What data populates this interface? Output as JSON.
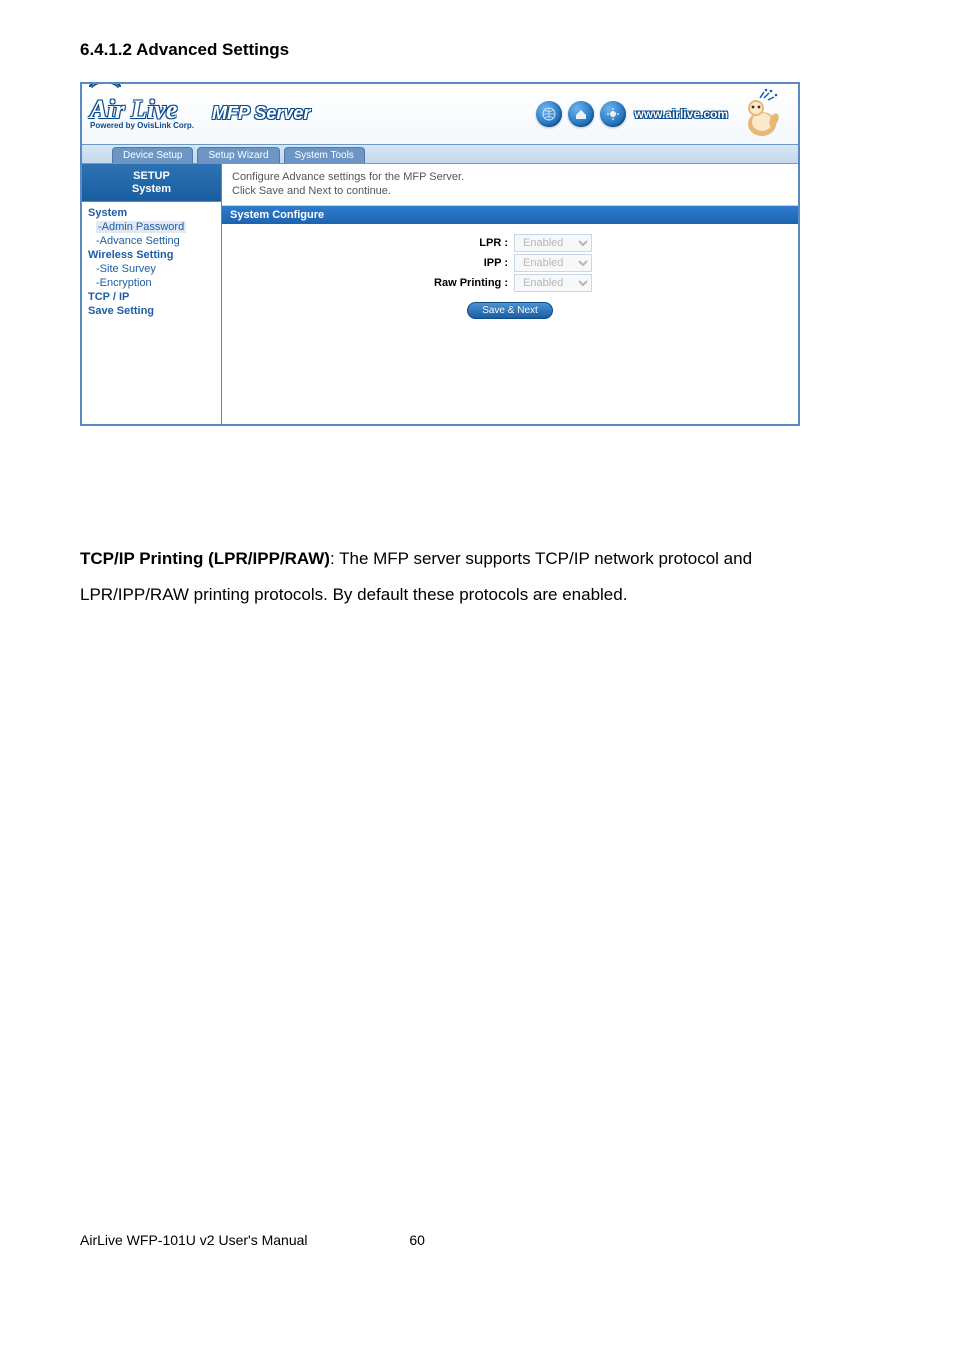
{
  "section": {
    "title": "6.4.1.2    Advanced Settings"
  },
  "logo": {
    "brand": "Air Live",
    "powered": "Powered by OvisLink Corp.",
    "product": "MFP Server",
    "site": "www.airlive.com"
  },
  "tabs": [
    "Device Setup",
    "Setup Wizard",
    "System Tools"
  ],
  "sidebar": {
    "header_line1": "SETUP",
    "header_line2": "System",
    "items": {
      "system": "System",
      "admin_password": "-Admin Password",
      "advance_setting": "-Advance Setting",
      "wireless_setting": "Wireless Setting",
      "site_survey": "-Site Survey",
      "encryption": "-Encryption",
      "tcpip": "TCP / IP",
      "save_setting": "Save Setting"
    }
  },
  "content": {
    "desc_line1": "Configure Advance settings for the MFP Server.",
    "desc_line2": "Click Save and Next to continue.",
    "panel_title": "System Configure",
    "rows": {
      "lpr": {
        "label": "LPR :",
        "value": "Enabled"
      },
      "ipp": {
        "label": "IPP :",
        "value": "Enabled"
      },
      "raw": {
        "label": "Raw Printing :",
        "value": "Enabled"
      }
    },
    "button": "Save & Next"
  },
  "paragraph_bold": "TCP/IP Printing (LPR/IPP/RAW)",
  "paragraph_rest": ": The MFP server supports TCP/IP network protocol and LPR/IPP/RAW printing protocols. By default these protocols are enabled.",
  "footer": {
    "left": "AirLive WFP-101U v2 User's Manual",
    "page": "60"
  }
}
